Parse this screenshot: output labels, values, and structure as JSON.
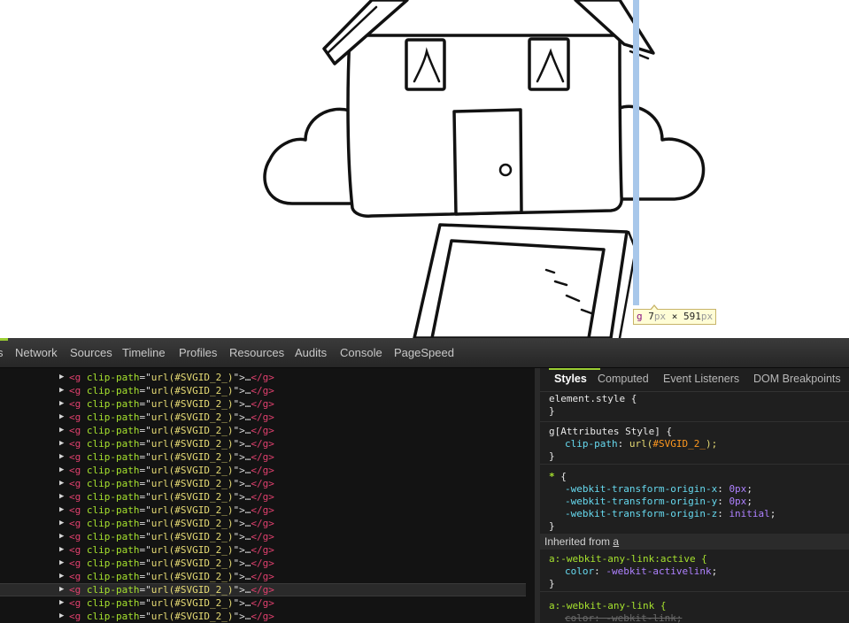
{
  "element_tooltip": {
    "tag": "g",
    "width_value": "7",
    "width_unit": "px",
    "times": "×",
    "height_value": "591",
    "height_unit": "px"
  },
  "devtools": {
    "panel_tabs": [
      "Network",
      "Sources",
      "Timeline",
      "Profiles",
      "Resources",
      "Audits",
      "Console",
      "PageSpeed"
    ],
    "dom_tree": {
      "selected_row_index": 16,
      "row": {
        "tag_open": "<g",
        "attr_name": "clip-path",
        "equals_quote": "=\"",
        "attr_value": "url(#SVGID_2_)",
        "quote_close": "\">",
        "ellipsis": "…",
        "tag_close": "</g>"
      },
      "row_count": 19
    },
    "sidebar": {
      "tabs": [
        "Styles",
        "Computed",
        "Event Listeners",
        "DOM Breakpoints"
      ],
      "active_tab": "Styles",
      "element_style": {
        "selector": "element.style {",
        "close": "}"
      },
      "attributes_style": {
        "selector": "g[Attributes Style] {",
        "prop": "clip-path",
        "value_func": "url(",
        "value_id": "#SVGID_2_",
        "value_end": ");",
        "close": "}"
      },
      "universal_rule": {
        "star": "*",
        "brace": "{",
        "props": [
          {
            "name": "-webkit-transform-origin-x",
            "value": "0px"
          },
          {
            "name": "-webkit-transform-origin-y",
            "value": "0px"
          },
          {
            "name": "-webkit-transform-origin-z",
            "value": "initial"
          }
        ],
        "close": "}"
      },
      "inherited": {
        "label": "Inherited from",
        "element": "a"
      },
      "any_link_active": {
        "selector": "a:-webkit-any-link:active {",
        "prop": "color",
        "value": "-webkit-activelink",
        "close": "}"
      },
      "any_link": {
        "selector": "a:-webkit-any-link {",
        "struck_prop": "color: -webkit-link;"
      }
    }
  }
}
